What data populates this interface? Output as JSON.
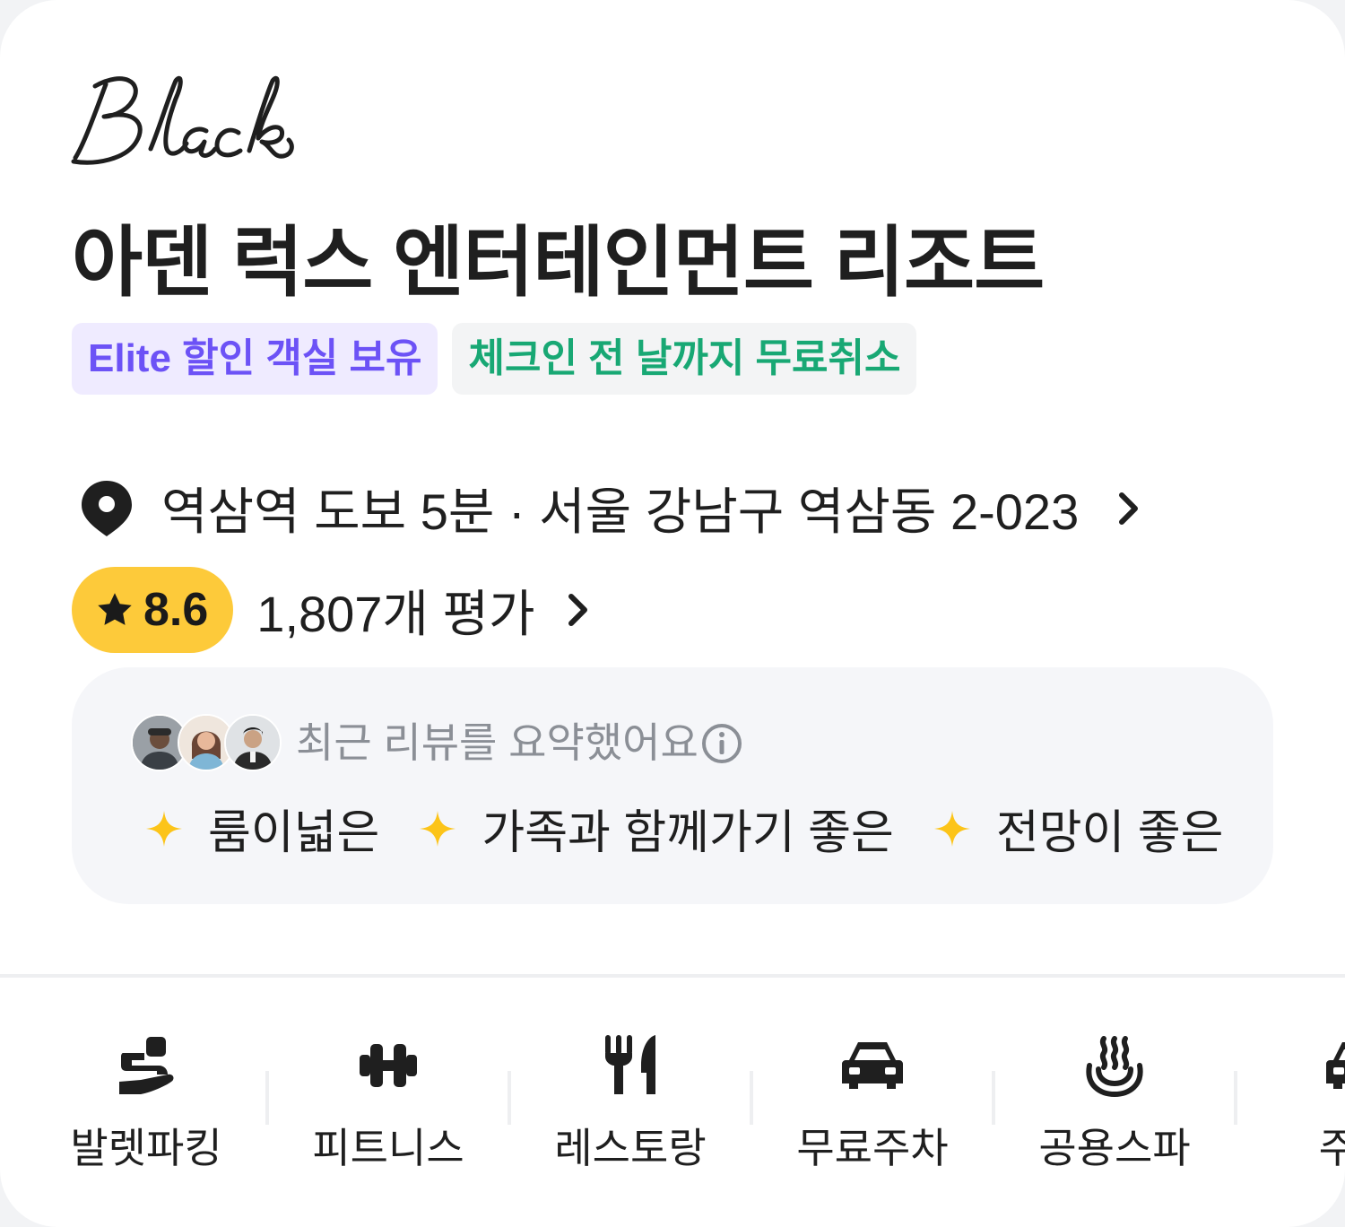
{
  "brand": {
    "logo_text": "Black"
  },
  "hotel": {
    "name": "아덴 럭스 엔터테인먼트 리조트"
  },
  "tags": [
    {
      "label": "Elite 할인 객실 보유"
    },
    {
      "label": "체크인 전 날까지 무료취소"
    }
  ],
  "location": {
    "text": "역삼역 도보 5분 · 서울 강남구 역삼동 2-023"
  },
  "rating": {
    "score": "8.6",
    "reviews": "1,807개 평가"
  },
  "review_summary": {
    "title": "최근 리뷰를 요약했어요",
    "keywords": [
      "룸이넓은",
      "가족과 함께가기 좋은",
      "전망이 좋은"
    ]
  },
  "amenities": [
    {
      "label": "발렛파킹",
      "icon": "valet-hand-icon"
    },
    {
      "label": "피트니스",
      "icon": "dumbbell-icon"
    },
    {
      "label": "레스토랑",
      "icon": "fork-knife-icon"
    },
    {
      "label": "무료주차",
      "icon": "car-icon"
    },
    {
      "label": "공용스파",
      "icon": "hot-spring-icon"
    },
    {
      "label": "주차",
      "icon": "car-icon"
    }
  ],
  "colors": {
    "elite_bg": "#efebff",
    "elite_text": "#6c52f6",
    "cancel_bg": "#f3f4f5",
    "cancel_text": "#18a874",
    "rating_badge": "#fdca3a",
    "sparkle": "#fcc419",
    "summary_bg": "#f5f6f9"
  }
}
